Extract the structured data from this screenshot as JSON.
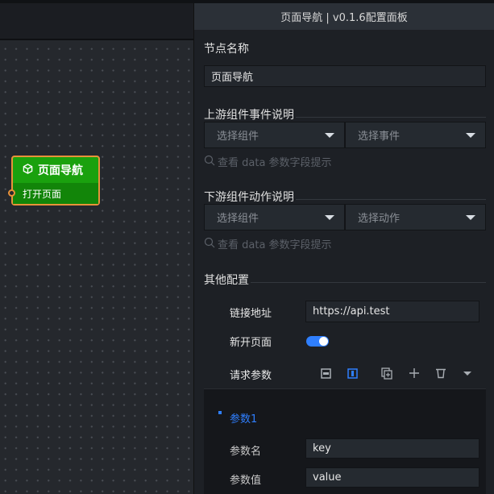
{
  "node": {
    "title": "页面导航",
    "action": "打开页面"
  },
  "panel": {
    "title": "页面导航 | v0.1.6配置面板",
    "node_name_label": "节点名称",
    "node_name_value": "页面导航",
    "upstream": {
      "title": "上游组件事件说明",
      "component_placeholder": "选择组件",
      "event_placeholder": "选择事件",
      "hint": "查看 data 参数字段提示"
    },
    "downstream": {
      "title": "下游组件动作说明",
      "component_placeholder": "选择组件",
      "action_placeholder": "选择动作",
      "hint": "查看 data 参数字段提示"
    },
    "other": {
      "title": "其他配置",
      "url_label": "链接地址",
      "url_value": "https://api.test",
      "new_page_label": "新开页面",
      "new_page_on": true,
      "params_label": "请求参数"
    },
    "param": {
      "title": "参数1",
      "name_label": "参数名",
      "name_value": "key",
      "value_label": "参数值",
      "value_value": "value"
    }
  },
  "colors": {
    "accent": "#2f7fff",
    "node_green": "#1aa10e",
    "node_border": "#e8923a"
  }
}
